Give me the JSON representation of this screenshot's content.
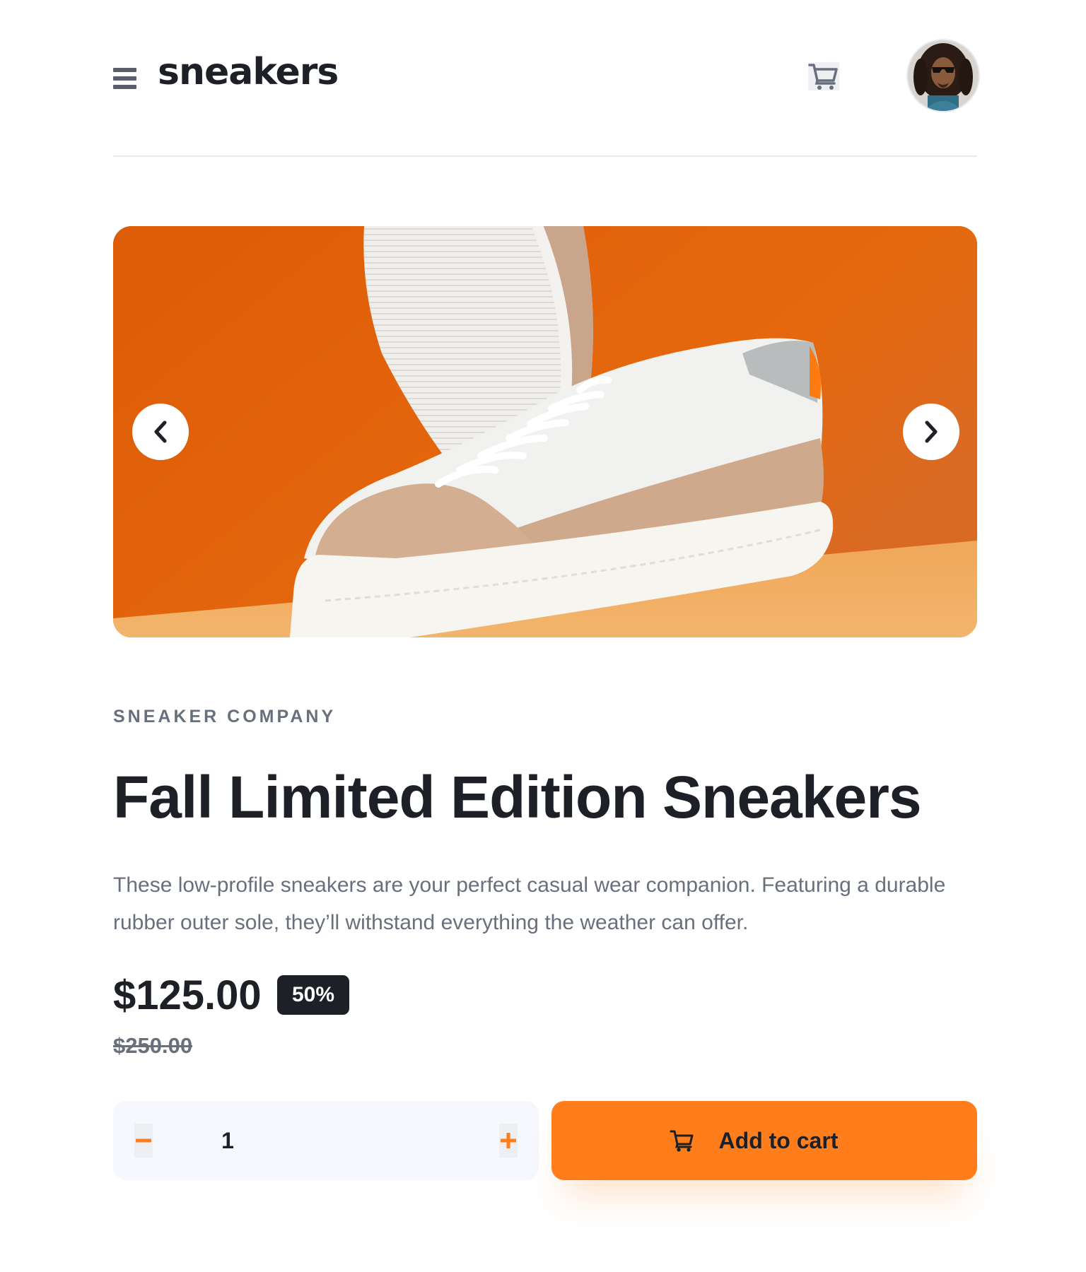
{
  "header": {
    "logo": "sneakers",
    "menu_icon": "hamburger-menu-icon",
    "cart_icon": "cart-icon",
    "avatar_alt": "user-avatar"
  },
  "gallery": {
    "prev_icon": "chevron-left-icon",
    "next_icon": "chevron-right-icon",
    "background_color": "#e2640a"
  },
  "product": {
    "company": "SNEAKER COMPANY",
    "title": "Fall Limited Edition Sneakers",
    "description": "These low-profile sneakers are your perfect casual wear companion. Featuring a durable rubber outer sole, they’ll withstand everything the weather can offer.",
    "price": "$125.00",
    "discount": "50%",
    "original_price": "$250.00"
  },
  "quantity": {
    "value": "1",
    "minus_icon": "minus-icon",
    "plus_icon": "plus-icon"
  },
  "cart_button": {
    "label": "Add to cart",
    "icon": "cart-icon"
  },
  "colors": {
    "accent": "#ff7e1b",
    "dark": "#1d2026",
    "muted": "#68707d",
    "light_bg": "#f6f8fd"
  }
}
